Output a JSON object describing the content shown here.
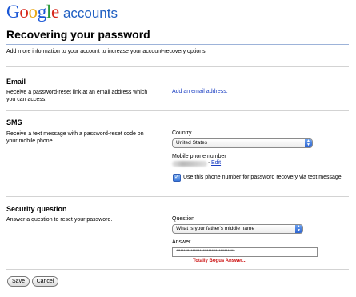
{
  "header": {
    "logo": {
      "letters": [
        "G",
        "o",
        "o",
        "g",
        "l",
        "e"
      ],
      "suffix": "accounts"
    },
    "title": "Recovering your password",
    "intro": "Add more information to your account to increase your account-recovery options."
  },
  "email_section": {
    "heading": "Email",
    "description": "Receive a password-reset link at an email address which you can access.",
    "add_link": "Add an email address."
  },
  "sms_section": {
    "heading": "SMS",
    "description": "Receive a text message with a password-reset code on your mobile phone.",
    "country_label": "Country",
    "country_value": "United States",
    "phone_label": "Mobile phone number",
    "phone_separator": "-",
    "edit_link": "Edit",
    "use_phone_checked": true,
    "use_phone_label": "Use this phone number for password recovery via text message."
  },
  "security_section": {
    "heading": "Security question",
    "description": "Answer a question to reset your password.",
    "question_label": "Question",
    "question_value": "What is your father's middle name",
    "answer_label": "Answer",
    "answer_value": "****************************************",
    "error_message": "Totally Bogus Answer..."
  },
  "buttons": {
    "save": "Save",
    "cancel": "Cancel"
  },
  "colors": {
    "link": "#1a3ec2",
    "error": "#cc1111",
    "logo_blue": "#1a57d6",
    "logo_red": "#d6291d",
    "logo_yellow": "#e8a816",
    "logo_green": "#2a9a3a",
    "select_arrow": "#2d64d0"
  },
  "icons": {
    "select_arrows": "up-down-arrows-icon",
    "checkbox": "checkmark-icon"
  }
}
